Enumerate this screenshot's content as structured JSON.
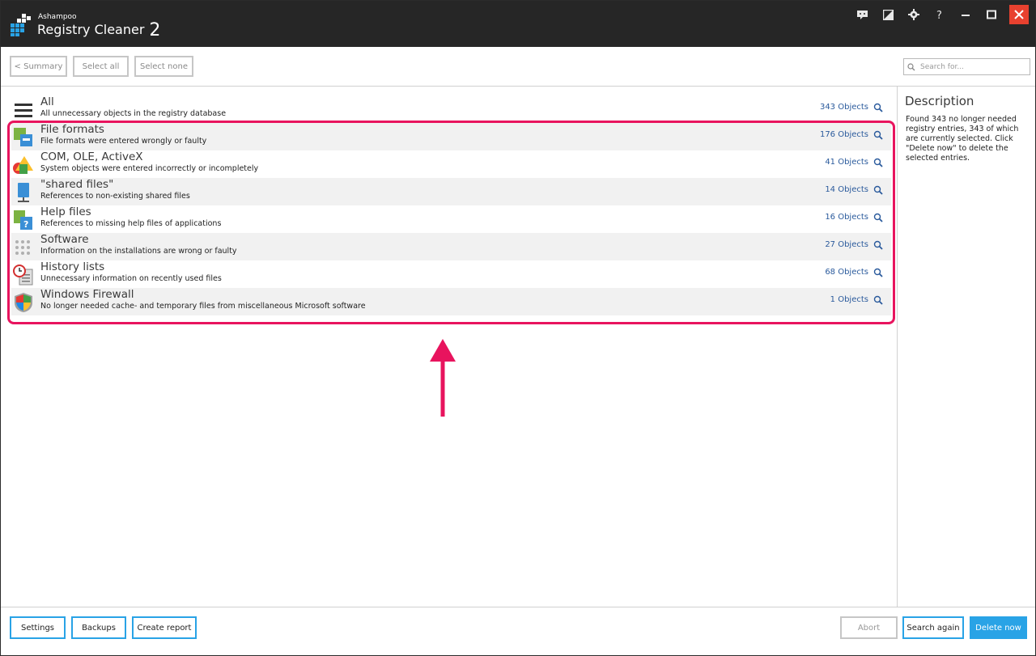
{
  "app": {
    "brand": "Ashampoo",
    "name": "Registry Cleaner",
    "version": "2"
  },
  "toolbar": {
    "summary_label": "< Summary",
    "select_all_label": "Select all",
    "select_none_label": "Select none",
    "search_placeholder": "Search for..."
  },
  "categories": [
    {
      "title": "All",
      "desc": "All unnecessary objects in the registry database",
      "count": "343 Objects",
      "icon": "list-icon"
    },
    {
      "title": "File formats",
      "desc": "File formats were entered wrongly or faulty",
      "count": "176 Objects",
      "icon": "file-formats-icon"
    },
    {
      "title": "COM, OLE, ActiveX",
      "desc": "System objects were entered incorrectly or incompletely",
      "count": "41 Objects",
      "icon": "com-ole-activex-icon"
    },
    {
      "title": "\"shared files\"",
      "desc": "References to non-existing shared files",
      "count": "14 Objects",
      "icon": "shared-files-icon"
    },
    {
      "title": "Help files",
      "desc": "References to missing help files of applications",
      "count": "16 Objects",
      "icon": "help-files-icon"
    },
    {
      "title": "Software",
      "desc": "Information on the installations are wrong or faulty",
      "count": "27 Objects",
      "icon": "software-icon"
    },
    {
      "title": "History lists",
      "desc": "Unnecessary information on recently used files",
      "count": "68 Objects",
      "icon": "history-lists-icon"
    },
    {
      "title": "Windows Firewall",
      "desc": "No longer needed cache- and temporary files from miscellaneous Microsoft software",
      "count": "1 Objects",
      "icon": "windows-firewall-icon"
    }
  ],
  "description": {
    "title": "Description",
    "text": "Found 343 no longer needed registry entries, 343 of which are currently selected. Click \"Delete now\" to delete the selected entries."
  },
  "bottom": {
    "settings_label": "Settings",
    "backups_label": "Backups",
    "create_report_label": "Create report",
    "abort_label": "Abort",
    "search_again_label": "Search again",
    "delete_now_label": "Delete now"
  },
  "colors": {
    "titlebar": "#262626",
    "accent": "#29a3e6",
    "highlight": "#e8145e",
    "link": "#2a5a9c",
    "close": "#e8412f"
  }
}
